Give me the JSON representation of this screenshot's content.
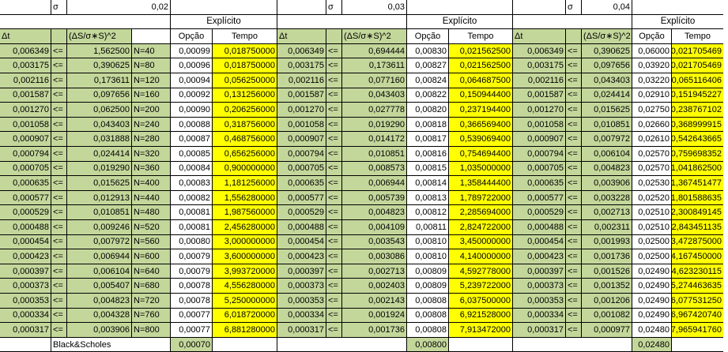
{
  "header": {
    "sigma_symbol": "σ",
    "blocks": [
      {
        "sigma": "0,02",
        "title": "Explícito"
      },
      {
        "sigma": "0,03",
        "title": "Explícito"
      },
      {
        "sigma": "0,04",
        "title": "Explícito"
      }
    ],
    "col_labels": {
      "dt": "Δt",
      "le": "<=",
      "ratio": "(ΔS/σ∗S)^2",
      "ratio_short": "(ΔS/σ∗S)^2",
      "opcao": "Opção",
      "tempo": "Tempo"
    }
  },
  "block1": {
    "rows": [
      {
        "dt": "0,006349",
        "le": "<=",
        "ratio": "1,562500",
        "n": "N=40",
        "opcao": "0,00099",
        "tempo": "0,018750000"
      },
      {
        "dt": "0,003175",
        "le": "<=",
        "ratio": "0,390625",
        "n": "N=80",
        "opcao": "0,00096",
        "tempo": "0,018750000"
      },
      {
        "dt": "0,002116",
        "le": "<=",
        "ratio": "0,173611",
        "n": "N=120",
        "opcao": "0,00094",
        "tempo": "0,056250000"
      },
      {
        "dt": "0,001587",
        "le": "<=",
        "ratio": "0,097656",
        "n": "N=160",
        "opcao": "0,00092",
        "tempo": "0,131256000"
      },
      {
        "dt": "0,001270",
        "le": "<=",
        "ratio": "0,062500",
        "n": "N=200",
        "opcao": "0,00090",
        "tempo": "0,206256000"
      },
      {
        "dt": "0,001058",
        "le": "<=",
        "ratio": "0,043403",
        "n": "N=240",
        "opcao": "0,00088",
        "tempo": "0,318756000"
      },
      {
        "dt": "0,000907",
        "le": "<=",
        "ratio": "0,031888",
        "n": "N=280",
        "opcao": "0,00087",
        "tempo": "0,468756000"
      },
      {
        "dt": "0,000794",
        "le": "<=",
        "ratio": "0,024414",
        "n": "N=320",
        "opcao": "0,00085",
        "tempo": "0,656256000"
      },
      {
        "dt": "0,000705",
        "le": "<=",
        "ratio": "0,019290",
        "n": "N=360",
        "opcao": "0,00084",
        "tempo": "0,900000000"
      },
      {
        "dt": "0,000635",
        "le": "<=",
        "ratio": "0,015625",
        "n": "N=400",
        "opcao": "0,00083",
        "tempo": "1,181256000"
      },
      {
        "dt": "0,000577",
        "le": "<=",
        "ratio": "0,012913",
        "n": "N=440",
        "opcao": "0,00082",
        "tempo": "1,556280000"
      },
      {
        "dt": "0,000529",
        "le": "<=",
        "ratio": "0,010851",
        "n": "N=480",
        "opcao": "0,00081",
        "tempo": "1,987560000"
      },
      {
        "dt": "0,000488",
        "le": "<=",
        "ratio": "0,009246",
        "n": "N=520",
        "opcao": "0,00081",
        "tempo": "2,456280000"
      },
      {
        "dt": "0,000454",
        "le": "<=",
        "ratio": "0,007972",
        "n": "N=560",
        "opcao": "0,00080",
        "tempo": "3,000000000"
      },
      {
        "dt": "0,000423",
        "le": "<=",
        "ratio": "0,006944",
        "n": "N=600",
        "opcao": "0,00079",
        "tempo": "3,600000000"
      },
      {
        "dt": "0,000397",
        "le": "<=",
        "ratio": "0,006104",
        "n": "N=640",
        "opcao": "0,00079",
        "tempo": "3,993720000"
      },
      {
        "dt": "0,000373",
        "le": "<=",
        "ratio": "0,005407",
        "n": "N=680",
        "opcao": "0,00078",
        "tempo": "4,556280000"
      },
      {
        "dt": "0,000353",
        "le": "<=",
        "ratio": "0,004823",
        "n": "N=720",
        "opcao": "0,00078",
        "tempo": "5,250000000"
      },
      {
        "dt": "0,000334",
        "le": "<=",
        "ratio": "0,004328",
        "n": "N=760",
        "opcao": "0,00077",
        "tempo": "6,018720000"
      },
      {
        "dt": "0,000317",
        "le": "<=",
        "ratio": "0,003906",
        "n": "N=800",
        "opcao": "0,00077",
        "tempo": "6,881280000"
      }
    ]
  },
  "block2": {
    "rows": [
      {
        "dt": "0,006349",
        "le": "<=",
        "ratio": "0,694444",
        "opcao": "0,00830",
        "tempo": "0,021562500"
      },
      {
        "dt": "0,003175",
        "le": "<=",
        "ratio": "0,173611",
        "opcao": "0,00827",
        "tempo": "0,021562500"
      },
      {
        "dt": "0,002116",
        "le": "<=",
        "ratio": "0,077160",
        "opcao": "0,00824",
        "tempo": "0,064687500"
      },
      {
        "dt": "0,001587",
        "le": "<=",
        "ratio": "0,043403",
        "opcao": "0,00822",
        "tempo": "0,150944400"
      },
      {
        "dt": "0,001270",
        "le": "<=",
        "ratio": "0,027778",
        "opcao": "0,00820",
        "tempo": "0,237194400"
      },
      {
        "dt": "0,001058",
        "le": "<=",
        "ratio": "0,019290",
        "opcao": "0,00818",
        "tempo": "0,366569400"
      },
      {
        "dt": "0,000907",
        "le": "<=",
        "ratio": "0,014172",
        "opcao": "0,00817",
        "tempo": "0,539069400"
      },
      {
        "dt": "0,000794",
        "le": "<=",
        "ratio": "0,010851",
        "opcao": "0,00816",
        "tempo": "0,754694400"
      },
      {
        "dt": "0,000705",
        "le": "<=",
        "ratio": "0,008573",
        "opcao": "0,00815",
        "tempo": "1,035000000"
      },
      {
        "dt": "0,000635",
        "le": "<=",
        "ratio": "0,006944",
        "opcao": "0,00814",
        "tempo": "1,358444400"
      },
      {
        "dt": "0,000577",
        "le": "<=",
        "ratio": "0,005739",
        "opcao": "0,00813",
        "tempo": "1,789722000"
      },
      {
        "dt": "0,000529",
        "le": "<=",
        "ratio": "0,004823",
        "opcao": "0,00812",
        "tempo": "2,285694000"
      },
      {
        "dt": "0,000488",
        "le": "<=",
        "ratio": "0,004109",
        "opcao": "0,00811",
        "tempo": "2,824722000"
      },
      {
        "dt": "0,000454",
        "le": "<=",
        "ratio": "0,003543",
        "opcao": "0,00810",
        "tempo": "3,450000000"
      },
      {
        "dt": "0,000423",
        "le": "<=",
        "ratio": "0,003086",
        "opcao": "0,00810",
        "tempo": "4,140000000"
      },
      {
        "dt": "0,000397",
        "le": "<=",
        "ratio": "0,002713",
        "opcao": "0,00809",
        "tempo": "4,592778000"
      },
      {
        "dt": "0,000373",
        "le": "<=",
        "ratio": "0,002403",
        "opcao": "0,00809",
        "tempo": "5,239722000"
      },
      {
        "dt": "0,000353",
        "le": "<=",
        "ratio": "0,002143",
        "opcao": "0,00808",
        "tempo": "6,037500000"
      },
      {
        "dt": "0,000334",
        "le": "<=",
        "ratio": "0,001924",
        "opcao": "0,00808",
        "tempo": "6,921528000"
      },
      {
        "dt": "0,000317",
        "le": "<=",
        "ratio": "0,001736",
        "opcao": "0,00808",
        "tempo": "7,913472000"
      }
    ]
  },
  "block3": {
    "rows": [
      {
        "dt": "0,006349",
        "le": "<=",
        "ratio": "0,390625",
        "opcao": "0,06000",
        "tempo": "0,021705469"
      },
      {
        "dt": "0,003175",
        "le": "<=",
        "ratio": "0,097656",
        "opcao": "0,03920",
        "tempo": "0,021705469"
      },
      {
        "dt": "0,002116",
        "le": "<=",
        "ratio": "0,043403",
        "opcao": "0,03220",
        "tempo": "0,065116406"
      },
      {
        "dt": "0,001587",
        "le": "<=",
        "ratio": "0,024414",
        "opcao": "0,02910",
        "tempo": "0,151945227"
      },
      {
        "dt": "0,001270",
        "le": "<=",
        "ratio": "0,015625",
        "opcao": "0,02750",
        "tempo": "0,238767102"
      },
      {
        "dt": "0,001058",
        "le": "<=",
        "ratio": "0,010851",
        "opcao": "0,02660",
        "tempo": "0,368999915"
      },
      {
        "dt": "0,000907",
        "le": "<=",
        "ratio": "0,007972",
        "opcao": "0,02610",
        "tempo": "0,542643665"
      },
      {
        "dt": "0,000794",
        "le": "<=",
        "ratio": "0,006104",
        "opcao": "0,02570",
        "tempo": "0,759698352"
      },
      {
        "dt": "0,000705",
        "le": "<=",
        "ratio": "0,004823",
        "opcao": "0,02570",
        "tempo": "1,041862500"
      },
      {
        "dt": "0,000635",
        "le": "<=",
        "ratio": "0,003906",
        "opcao": "0,02530",
        "tempo": "1,367451477"
      },
      {
        "dt": "0,000577",
        "le": "<=",
        "ratio": "0,003228",
        "opcao": "0,02520",
        "tempo": "1,801588635"
      },
      {
        "dt": "0,000529",
        "le": "<=",
        "ratio": "0,002713",
        "opcao": "0,02510",
        "tempo": "2,300849145"
      },
      {
        "dt": "0,000488",
        "le": "<=",
        "ratio": "0,002311",
        "opcao": "0,02510",
        "tempo": "2,843451135"
      },
      {
        "dt": "0,000454",
        "le": "<=",
        "ratio": "0,001993",
        "opcao": "0,02500",
        "tempo": "3,472875000"
      },
      {
        "dt": "0,000423",
        "le": "<=",
        "ratio": "0,001736",
        "opcao": "0,02500",
        "tempo": "4,167450000"
      },
      {
        "dt": "0,000397",
        "le": "<=",
        "ratio": "0,001526",
        "opcao": "0,02490",
        "tempo": "4,623230115"
      },
      {
        "dt": "0,000373",
        "le": "<=",
        "ratio": "0,001352",
        "opcao": "0,02490",
        "tempo": "5,274463635"
      },
      {
        "dt": "0,000353",
        "le": "<=",
        "ratio": "0,001206",
        "opcao": "0,02490",
        "tempo": "6,077531250"
      },
      {
        "dt": "0,000334",
        "le": "<=",
        "ratio": "0,001082",
        "opcao": "0,02490",
        "tempo": "6,967420740"
      },
      {
        "dt": "0,000317",
        "le": "<=",
        "ratio": "0,000977",
        "opcao": "0,02480",
        "tempo": "7,965941760"
      }
    ]
  },
  "footer": {
    "label": "Black&Scholes",
    "values": [
      "0,00070",
      "0,00800",
      "0,02480"
    ]
  }
}
